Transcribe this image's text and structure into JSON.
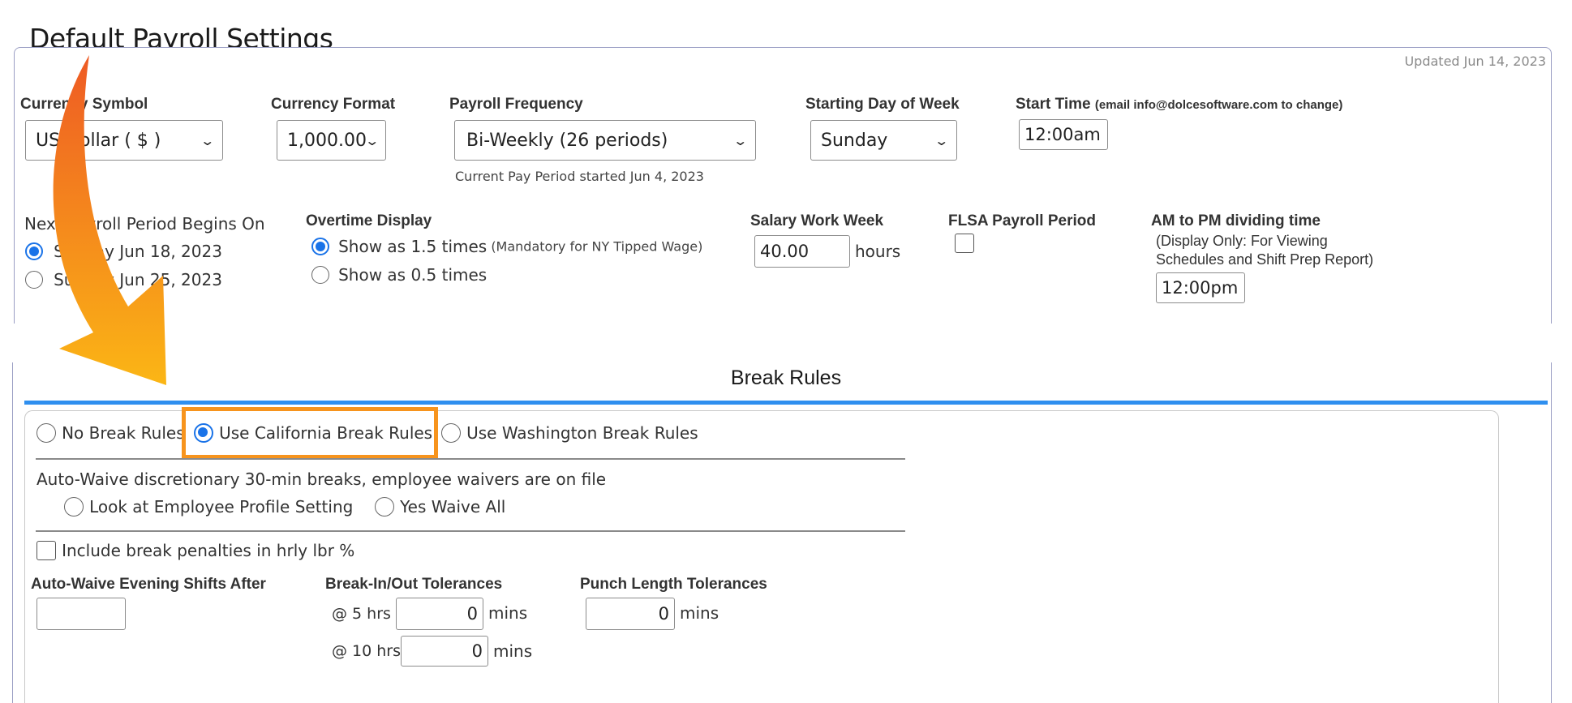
{
  "page_title": "Default Payroll Settings",
  "updated": "Updated Jun 14, 2023",
  "currency_symbol": {
    "label": "Currency Symbol",
    "value": "US Dollar ( $ )"
  },
  "currency_format": {
    "label": "Currency Format",
    "value": "1,000.00"
  },
  "payroll_frequency": {
    "label": "Payroll Frequency",
    "value": "Bi-Weekly (26 periods)",
    "note": "Current Pay Period started Jun 4, 2023"
  },
  "starting_day": {
    "label": "Starting Day of Week",
    "value": "Sunday"
  },
  "start_time": {
    "label": "Start Time",
    "note": "(email info@dolcesoftware.com to change)",
    "value": "12:00am"
  },
  "next_period": {
    "label": "Next Payroll Period Begins On",
    "options": [
      "Sunday Jun 18, 2023",
      "Sunday Jun 25, 2023"
    ],
    "selected": 0
  },
  "overtime": {
    "label": "Overtime Display",
    "options": [
      "Show as 1.5 times",
      "Show as 0.5 times"
    ],
    "option1_note": "(Mandatory for NY Tipped Wage)",
    "selected": 0
  },
  "salary_week": {
    "label": "Salary Work Week",
    "value": "40.00",
    "unit": "hours"
  },
  "flsa": {
    "label": "FLSA Payroll Period",
    "checked": false
  },
  "am_pm": {
    "label": "AM to PM dividing time",
    "note_line1": "(Display Only: For Viewing",
    "note_line2": "Schedules and Shift Prep Report)",
    "value": "12:00pm"
  },
  "break_rules": {
    "title": "Break Rules",
    "options": [
      "No Break Rules",
      "Use California Break Rules",
      "Use Washington Break Rules"
    ],
    "selected": 1,
    "auto_waive_text": "Auto-Waive discretionary 30-min breaks, employee waivers are on file",
    "waive_options": [
      "Look at Employee Profile Setting",
      "Yes Waive All"
    ],
    "include_penalties": "Include break penalties in hrly lbr %",
    "evening_label": "Auto-Waive Evening Shifts After",
    "evening_value": "",
    "tolerance_label": "Break-In/Out Tolerances",
    "tol5_label": "@ 5 hrs",
    "tol5_value": "0",
    "tol10_label": "@ 10 hrs",
    "tol10_value": "0",
    "mins": "mins",
    "punch_label": "Punch Length Tolerances",
    "punch_value": "0"
  },
  "colors": {
    "accent": "#1a73e8",
    "highlight": "#f7941d",
    "divider": "#2f8fef",
    "arrow_top": "#ee5a24",
    "arrow_bottom": "#fbb615"
  }
}
